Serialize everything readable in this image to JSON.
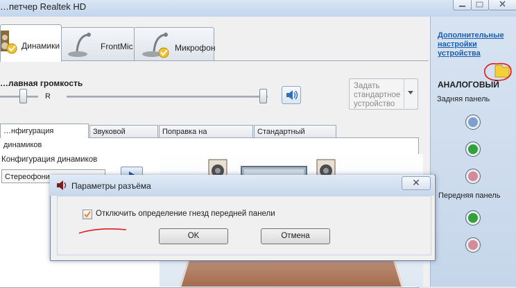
{
  "window": {
    "title": "…петчер Realtek HD",
    "minimize_icon": "minimize-icon",
    "maximize_icon": "maximize-icon",
    "close_icon": "close-icon"
  },
  "main_tabs": [
    {
      "label": "Динамики",
      "icon": "speaker-icon",
      "active": true
    },
    {
      "label": "FrontMic",
      "icon": "microphone-icon",
      "active": false
    },
    {
      "label": "Микрофон",
      "icon": "microphone-icon",
      "active": false
    }
  ],
  "volume": {
    "label": "…лавная громкость",
    "right_channel": "R",
    "balance_level": 0.5,
    "volume_level": 1.0,
    "mute_icon": "speaker-volume-icon"
  },
  "default_device": {
    "label": "Задать стандартное устройство",
    "dropdown_icon": "chevron-down-icon"
  },
  "sub_tabs": [
    {
      "label": "…нфигурация динамиков",
      "active": true
    },
    {
      "label": "Звуковой эффект",
      "active": false
    },
    {
      "label": "Поправка на помещение",
      "active": false
    },
    {
      "label": "Стандартный формат",
      "active": false
    }
  ],
  "speaker_config": {
    "label": "Конфигурация динамиков",
    "selected": "Стереофони…",
    "play_icon": "play-icon"
  },
  "right_panel": {
    "link": "Дополнительные настройки устройства",
    "folder_icon": "folder-icon",
    "analog_label": "АНАЛОГОВЫЙ",
    "rear_label": "Задняя панель",
    "front_label": "Передняя панель",
    "rear_jacks": [
      "#7f9fd2",
      "#33a13a",
      "#d58a98"
    ],
    "front_jacks": [
      "#33a13a",
      "#d58a98"
    ]
  },
  "dialog": {
    "title": "Параметры разъёма",
    "title_icon": "speaker-icon",
    "close_label": "✕",
    "checkbox_label": "Отключить определение гнезд передней панели",
    "checkbox_checked": true,
    "ok_label": "OK",
    "cancel_label": "Отмена"
  },
  "colors": {
    "accent": "#1a5fb4",
    "annotation_red": "#e0191b",
    "folder_yellow": "#f3cf3a"
  }
}
